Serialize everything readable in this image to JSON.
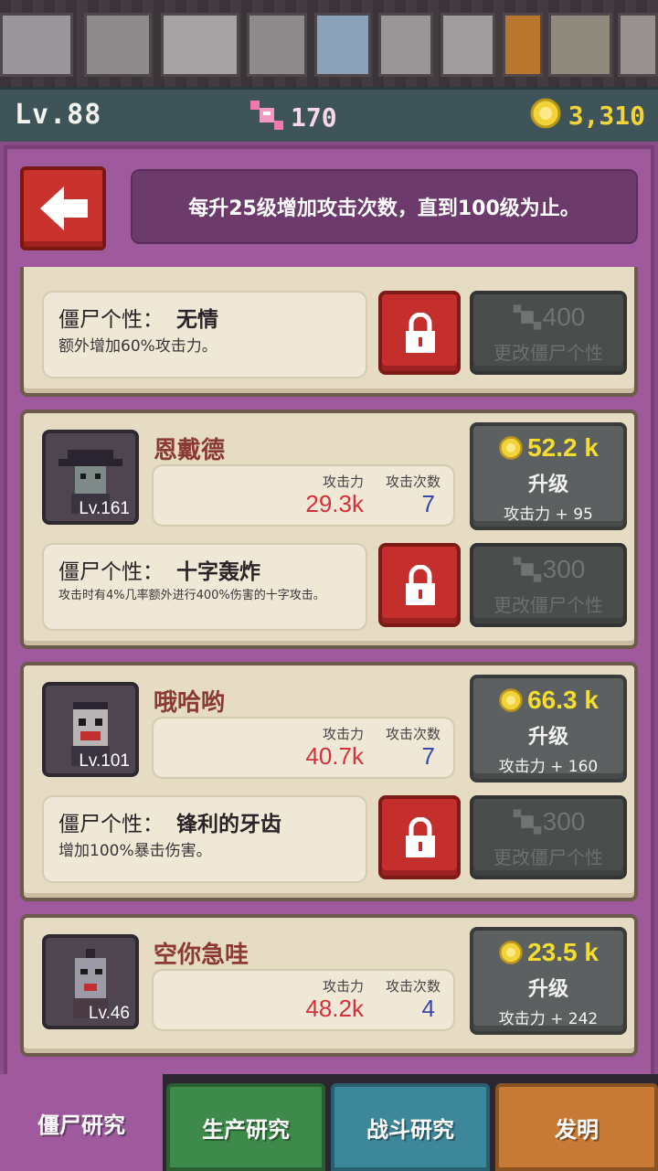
{
  "header": {
    "level": "Lv.88",
    "candy": "170",
    "gold": "3,310"
  },
  "info_text": "每升25级增加攻击次数，直到100级为止。",
  "top_partial": {
    "trait_label": "僵尸个性：",
    "trait_name": "无情",
    "trait_desc": "额外增加60%攻击力。",
    "change_cost": "400",
    "change_label": "更改僵尸个性"
  },
  "zombies": [
    {
      "name": "恩戴德",
      "level": "Lv.161",
      "atk_header": "攻击力",
      "cnt_header": "攻击次数",
      "atk": "29.3k",
      "cnt": "7",
      "upgrade_cost": "52.2 k",
      "upgrade_label": "升级",
      "upgrade_bonus": "攻击力 + 95",
      "trait_label": "僵尸个性：",
      "trait_name": "十字轰炸",
      "trait_desc": "攻击时有4%几率额外进行400%伤害的十字攻击。",
      "change_cost": "300",
      "change_label": "更改僵尸个性"
    },
    {
      "name": "哦哈哟",
      "level": "Lv.101",
      "atk_header": "攻击力",
      "cnt_header": "攻击次数",
      "atk": "40.7k",
      "cnt": "7",
      "upgrade_cost": "66.3 k",
      "upgrade_label": "升级",
      "upgrade_bonus": "攻击力 + 160",
      "trait_label": "僵尸个性：",
      "trait_name": "锋利的牙齿",
      "trait_desc": "增加100%暴击伤害。",
      "change_cost": "300",
      "change_label": "更改僵尸个性"
    },
    {
      "name": "空你急哇",
      "level": "Lv.46",
      "atk_header": "攻击力",
      "cnt_header": "攻击次数",
      "atk": "48.2k",
      "cnt": "4",
      "upgrade_cost": "23.5 k",
      "upgrade_label": "升级",
      "upgrade_bonus": "攻击力 + 242"
    }
  ],
  "tabs": [
    "僵尸研究",
    "生产研究",
    "战斗研究",
    "发明"
  ],
  "colors": {
    "panel": "#9f5a9e",
    "card": "#e6dcc4",
    "gold": "#f4dd2e",
    "attack": "#d3323c",
    "count": "#3a46a8",
    "lock_red": "#c42f2d"
  },
  "icons": {
    "back": "left-arrow-icon",
    "candy": "candy-icon",
    "coin": "gold-coin-icon",
    "lock": "padlock-icon"
  }
}
